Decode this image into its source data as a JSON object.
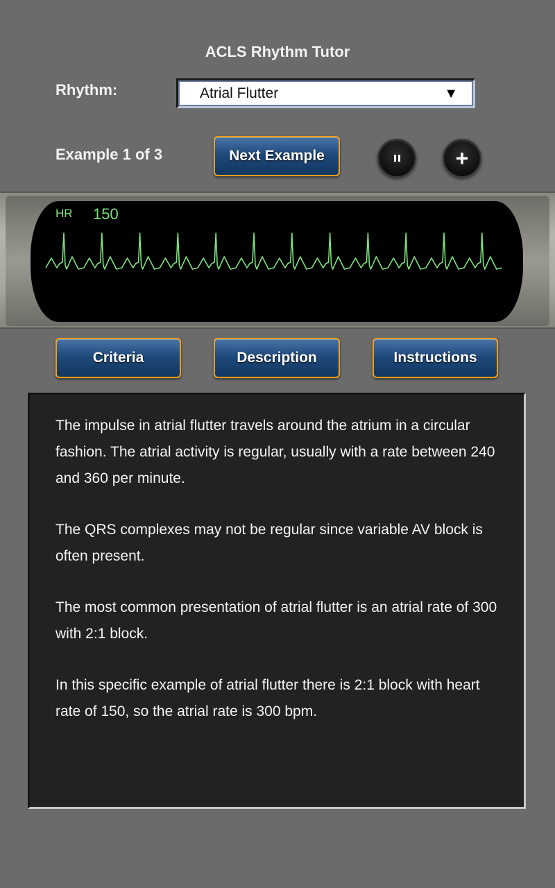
{
  "header": {
    "title": "ACLS Rhythm Tutor"
  },
  "rhythm": {
    "label": "Rhythm:",
    "selected": "Atrial Flutter"
  },
  "example": {
    "label": "Example 1 of 3",
    "next_label": "Next Example"
  },
  "controls": {
    "pause_icon": "pause-icon",
    "plus_icon": "plus-icon",
    "plus_glyph": "+"
  },
  "monitor": {
    "hr_label": "HR",
    "hr_value": "150",
    "trace_color": "#7de27d"
  },
  "tabs": {
    "criteria": "Criteria",
    "description": "Description",
    "instructions": "Instructions"
  },
  "description": {
    "paragraphs": [
      "The impulse in atrial flutter travels around the atrium in a circular fashion. The atrial activity is regular, usually with a rate between 240 and 360 per minute.",
      "The QRS complexes may not be regular since variable AV block is often present.",
      "The most common presentation of atrial flutter is an atrial rate of 300 with 2:1 block.",
      "In this specific example of atrial flutter there is 2:1 block with heart rate of 150, so the atrial rate is 300 bpm."
    ]
  },
  "colors": {
    "button_border": "#f0a11a",
    "button_fill": "#1f4a7c",
    "background": "#6b6b6b"
  }
}
